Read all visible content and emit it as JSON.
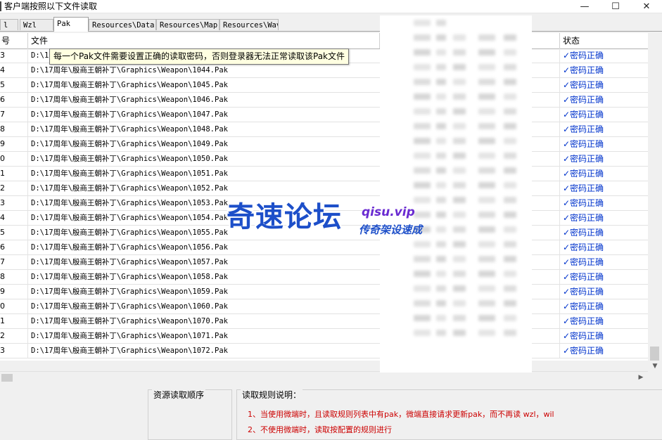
{
  "window": {
    "title": "客户端按照以下文件读取",
    "minimize_glyph": "—",
    "maximize_glyph": "☐",
    "close_glyph": "✕"
  },
  "tabs": [
    {
      "label": "l"
    },
    {
      "label": "Wzl"
    },
    {
      "label": "Pak",
      "active": true
    },
    {
      "label": "Resources\\Data"
    },
    {
      "label": "Resources\\Map"
    },
    {
      "label": "Resources\\Wav"
    }
  ],
  "table": {
    "columns": {
      "no": "号",
      "file": "文件",
      "status": "状态"
    },
    "status_label": "✓密码正确",
    "rows": [
      {
        "no": "3",
        "file": "D:\\17"
      },
      {
        "no": "4",
        "file": "D:\\17周年\\殷商王朝补丁\\Graphics\\Weapon\\1044.Pak"
      },
      {
        "no": "5",
        "file": "D:\\17周年\\殷商王朝补丁\\Graphics\\Weapon\\1045.Pak"
      },
      {
        "no": "6",
        "file": "D:\\17周年\\殷商王朝补丁\\Graphics\\Weapon\\1046.Pak"
      },
      {
        "no": "7",
        "file": "D:\\17周年\\殷商王朝补丁\\Graphics\\Weapon\\1047.Pak"
      },
      {
        "no": "8",
        "file": "D:\\17周年\\殷商王朝补丁\\Graphics\\Weapon\\1048.Pak"
      },
      {
        "no": "9",
        "file": "D:\\17周年\\殷商王朝补丁\\Graphics\\Weapon\\1049.Pak"
      },
      {
        "no": "0",
        "file": "D:\\17周年\\殷商王朝补丁\\Graphics\\Weapon\\1050.Pak"
      },
      {
        "no": "1",
        "file": "D:\\17周年\\殷商王朝补丁\\Graphics\\Weapon\\1051.Pak"
      },
      {
        "no": "2",
        "file": "D:\\17周年\\殷商王朝补丁\\Graphics\\Weapon\\1052.Pak"
      },
      {
        "no": "3",
        "file": "D:\\17周年\\殷商王朝补丁\\Graphics\\Weapon\\1053.Pak"
      },
      {
        "no": "4",
        "file": "D:\\17周年\\殷商王朝补丁\\Graphics\\Weapon\\1054.Pak"
      },
      {
        "no": "5",
        "file": "D:\\17周年\\殷商王朝补丁\\Graphics\\Weapon\\1055.Pak"
      },
      {
        "no": "6",
        "file": "D:\\17周年\\殷商王朝补丁\\Graphics\\Weapon\\1056.Pak"
      },
      {
        "no": "7",
        "file": "D:\\17周年\\殷商王朝补丁\\Graphics\\Weapon\\1057.Pak"
      },
      {
        "no": "8",
        "file": "D:\\17周年\\殷商王朝补丁\\Graphics\\Weapon\\1058.Pak"
      },
      {
        "no": "9",
        "file": "D:\\17周年\\殷商王朝补丁\\Graphics\\Weapon\\1059.Pak"
      },
      {
        "no": "0",
        "file": "D:\\17周年\\殷商王朝补丁\\Graphics\\Weapon\\1060.Pak"
      },
      {
        "no": "1",
        "file": "D:\\17周年\\殷商王朝补丁\\Graphics\\Weapon\\1070.Pak"
      },
      {
        "no": "2",
        "file": "D:\\17周年\\殷商王朝补丁\\Graphics\\Weapon\\1071.Pak"
      },
      {
        "no": "3",
        "file": "D:\\17周年\\殷商王朝补丁\\Graphics\\Weapon\\1072.Pak"
      }
    ]
  },
  "tooltip": {
    "text": "每一个Pak文件需要设置正确的读取密码，否则登录器无法正常读取该Pak文件"
  },
  "scrollbars": {
    "down_arrow": "▼",
    "right_arrow": "▶"
  },
  "bottom": {
    "order_title": "资源读取顺序",
    "rules_title": "读取规则说明：",
    "rules": [
      "1、当使用微端时，且读取规则列表中有pak，微端直接请求更新pak，而不再读 wzl，wil",
      "2、不使用微端时，读取按配置的规则进行"
    ]
  },
  "watermark": {
    "main": "奇速论坛",
    "url": "qisu.vip",
    "tagline": "传奇架设速成"
  },
  "colors": {
    "status_ok": "#0033cc",
    "rule_text": "#cc0000",
    "watermark_blue": "#1d4fc9",
    "watermark_purple": "#6a2bd1"
  }
}
